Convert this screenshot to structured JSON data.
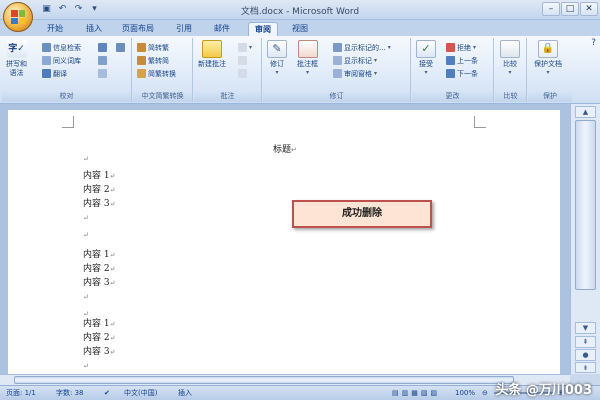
{
  "window": {
    "title": "文档.docx - Microsoft Word"
  },
  "window_controls": {
    "minimize": "–",
    "maximize": "□",
    "close": "✕"
  },
  "tabs": [
    "开始",
    "插入",
    "页面布局",
    "引用",
    "邮件",
    "审阅",
    "视图"
  ],
  "active_tab": "审阅",
  "ribbon": {
    "proofing": {
      "label": "校对",
      "spell": "拼写和\n语法",
      "research": "信息检索",
      "thesaurus": "同义词库",
      "translate": "翻译"
    },
    "chinese_conversion": {
      "label": "中文简繁转换",
      "to_traditional": "简转繁",
      "to_simplified": "繁转简",
      "convert": "简繁转换"
    },
    "comments": {
      "label": "批注",
      "new_comment": "新建批注"
    },
    "tracking": {
      "label": "修订",
      "track_changes": "修订",
      "balloons": "批注框",
      "display_markup": "显示标记的...",
      "show_markup": "显示标记",
      "reviewing_pane": "审阅窗格"
    },
    "changes": {
      "label": "更改",
      "accept": "接受",
      "reject": "拒绝",
      "previous": "上一条",
      "next": "下一条"
    },
    "compare": {
      "label": "比较",
      "compare": "比较"
    },
    "protect": {
      "label": "保护",
      "protect_doc": "保护文档"
    }
  },
  "document": {
    "heading": "标题",
    "mark": "↵",
    "lines": [
      "内容 1",
      "内容 2",
      "内容 3",
      "内容 1",
      "内容 2",
      "内容 3",
      "内容 1",
      "内容 2",
      "内容 3"
    ],
    "popup": "成功删除"
  },
  "statusbar": {
    "page": "页面: 1/1",
    "words": "字数: 38",
    "language": "中文(中国)",
    "mode": "插入",
    "zoom": "100%"
  },
  "watermark": "头条 @万川003",
  "colors": {
    "ribbon_text": "#15428b",
    "popup_border": "#c0504d",
    "popup_bg": "#fde4d4"
  }
}
